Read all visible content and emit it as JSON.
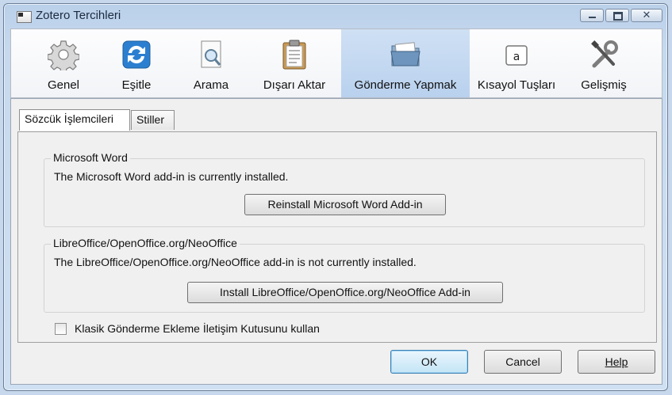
{
  "window": {
    "title": "Zotero Tercihleri",
    "buttons": {
      "minimize": "minimize",
      "maximize": "maximize",
      "close": "✕"
    }
  },
  "toolbar": {
    "items": [
      {
        "label": "Genel",
        "icon": "gear-icon"
      },
      {
        "label": "Eşitle",
        "icon": "sync-icon"
      },
      {
        "label": "Arama",
        "icon": "search-document-icon"
      },
      {
        "label": "Dışarı Aktar",
        "icon": "clipboard-icon"
      },
      {
        "label": "Gönderme Yapmak",
        "icon": "folder-icon",
        "selected": true
      },
      {
        "label": "Kısayol Tuşları",
        "icon": "keyboard-key-icon",
        "key": "a"
      },
      {
        "label": "Gelişmiş",
        "icon": "tools-icon"
      }
    ]
  },
  "tabs": [
    {
      "label": "Sözcük İşlemcileri",
      "active": true
    },
    {
      "label": "Stiller",
      "active": false
    }
  ],
  "word": {
    "title": "Microsoft Word",
    "status": "The Microsoft Word add-in is currently installed.",
    "button": "Reinstall Microsoft Word Add-in"
  },
  "libreoffice": {
    "title": "LibreOffice/OpenOffice.org/NeoOffice",
    "status": "The LibreOffice/OpenOffice.org/NeoOffice add-in is not currently installed.",
    "button": "Install LibreOffice/OpenOffice.org/NeoOffice Add-in"
  },
  "classic_dialog": {
    "label": "Klasik Gönderme Ekleme İletişim Kutusunu kullan",
    "checked": false
  },
  "dialog_buttons": {
    "ok": "OK",
    "cancel": "Cancel",
    "help": "Help"
  },
  "colors": {
    "selected_toolbar": "#bfd5ef",
    "default_button_border": "#3c7fb1"
  }
}
